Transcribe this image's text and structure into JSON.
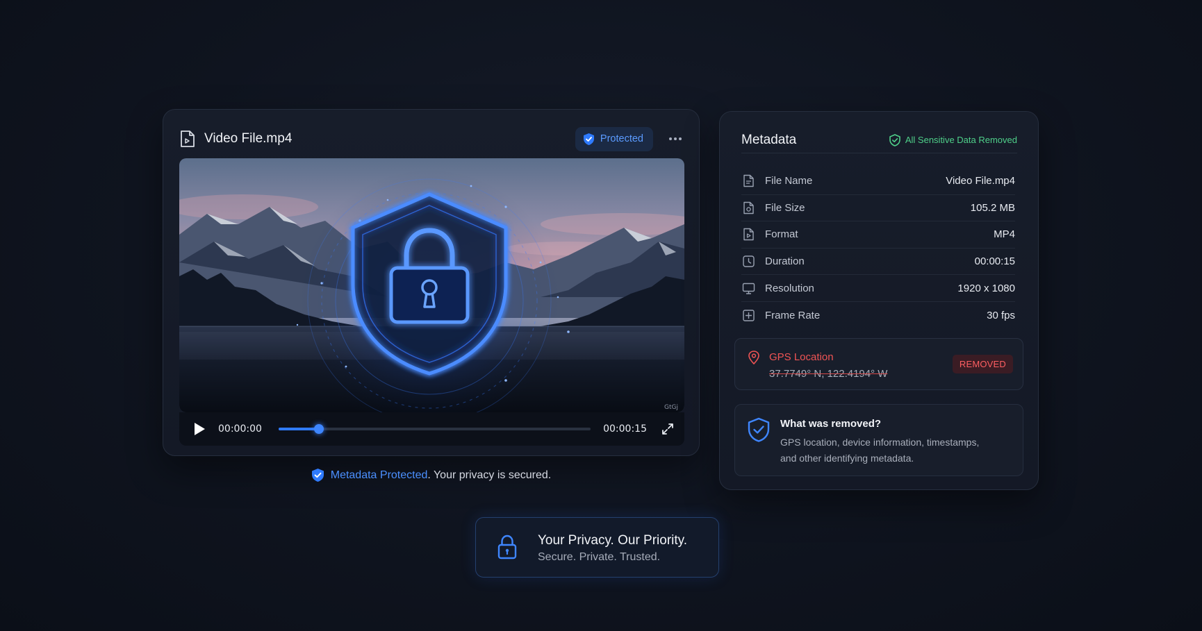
{
  "video_card": {
    "file_name": "Video File.mp4",
    "status_badge": "Protected",
    "player": {
      "current_time": "00:00:00",
      "duration": "00:00:15",
      "progress": 0.13,
      "watermark": "GtGj"
    }
  },
  "protected_note": {
    "highlight": "Metadata Protected",
    "text": ". Your privacy is secured."
  },
  "metadata_card": {
    "title": "Metadata",
    "status": "All Sensitive Data Removed",
    "rows": [
      {
        "icon": "file-icon",
        "label": "File Name",
        "value": "Video File.mp4"
      },
      {
        "icon": "file-size-icon",
        "label": "File Size",
        "value": "105.2 MB"
      },
      {
        "icon": "format-icon",
        "label": "Format",
        "value": "MP4"
      },
      {
        "icon": "clock-icon",
        "label": "Duration",
        "value": "00:00:15"
      },
      {
        "icon": "monitor-icon",
        "label": "Resolution",
        "value": "1920 x 1080"
      },
      {
        "icon": "frame-rate-icon",
        "label": "Frame Rate",
        "value": "30 fps"
      }
    ],
    "gps": {
      "label": "GPS Location",
      "coords": "37.7749° N, 122.4194° W",
      "badge": "REMOVED"
    },
    "removed_info": {
      "title": "What was removed?",
      "text": "GPS location, device information, timestamps, and other identifying metadata."
    }
  },
  "privacy_card": {
    "title": "Your Privacy. Our Priority.",
    "subtitle": "Secure. Private. Trusted."
  },
  "colors": {
    "accent_blue": "#2f7bff",
    "success_green": "#4fd08a",
    "danger_red": "#f05454",
    "background": "#0f141f"
  }
}
